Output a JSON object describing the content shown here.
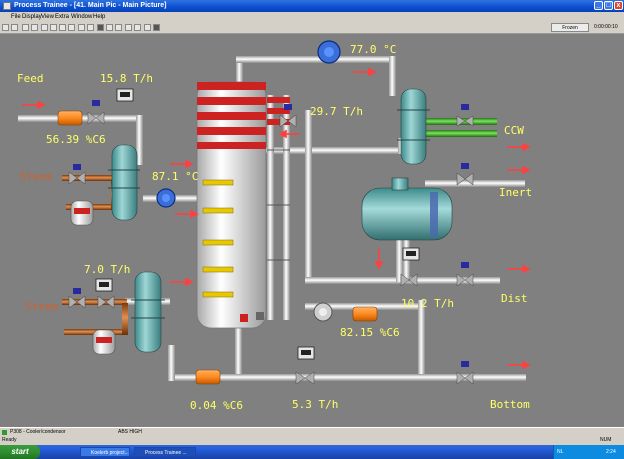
{
  "window": {
    "title": "Process Trainee - [41. Main Pic - Main Picture]",
    "controls": {
      "minimize": "_",
      "maximize": "□",
      "close": "x"
    }
  },
  "menu": [
    "File",
    "Display",
    "View",
    "Extra",
    "Window",
    "Help"
  ],
  "toolbar": {
    "frozen_label": "Frozen",
    "clock": "0:00:00:10"
  },
  "process": {
    "feed_label": "Feed",
    "feed_flow": "15.8 T/h",
    "feed_composition": "56.39 %C6",
    "steam_label_upper": "Steam",
    "steam_label_lower": "Steam",
    "column_temp": "87.1 °C",
    "top_temp": "77.0 °C",
    "reflux_flow": "29.7 T/h",
    "ccw_label": "CCW",
    "inert_label": "Inert",
    "dist_label": "Dist",
    "dist_flow": "10.2 T/h",
    "dist_composition": "82.15 %C6",
    "reboiler_steam_flow": "7.0 T/h",
    "bottom_composition": "0.04 %C6",
    "bottom_flow": "5.3 T/h",
    "bottom_label": "Bottom"
  },
  "colors": {
    "background": "#808080",
    "label_text": "#ffff66",
    "steam_text": "#c86432",
    "arrow": "#ff4040",
    "column_band": "#cc2222",
    "ccw_pipe": "#33aa22"
  },
  "status": {
    "alarm_tag": "P308 - Cooler/condensor",
    "alarm_text": "ABS HIGH",
    "ready": "Ready",
    "num": "NUM"
  },
  "taskbar": {
    "start": "start",
    "tasks": [
      "Koelerb project...",
      "Process Trainee ..."
    ],
    "tray_lang": "NL",
    "tray_time": "2:24"
  }
}
